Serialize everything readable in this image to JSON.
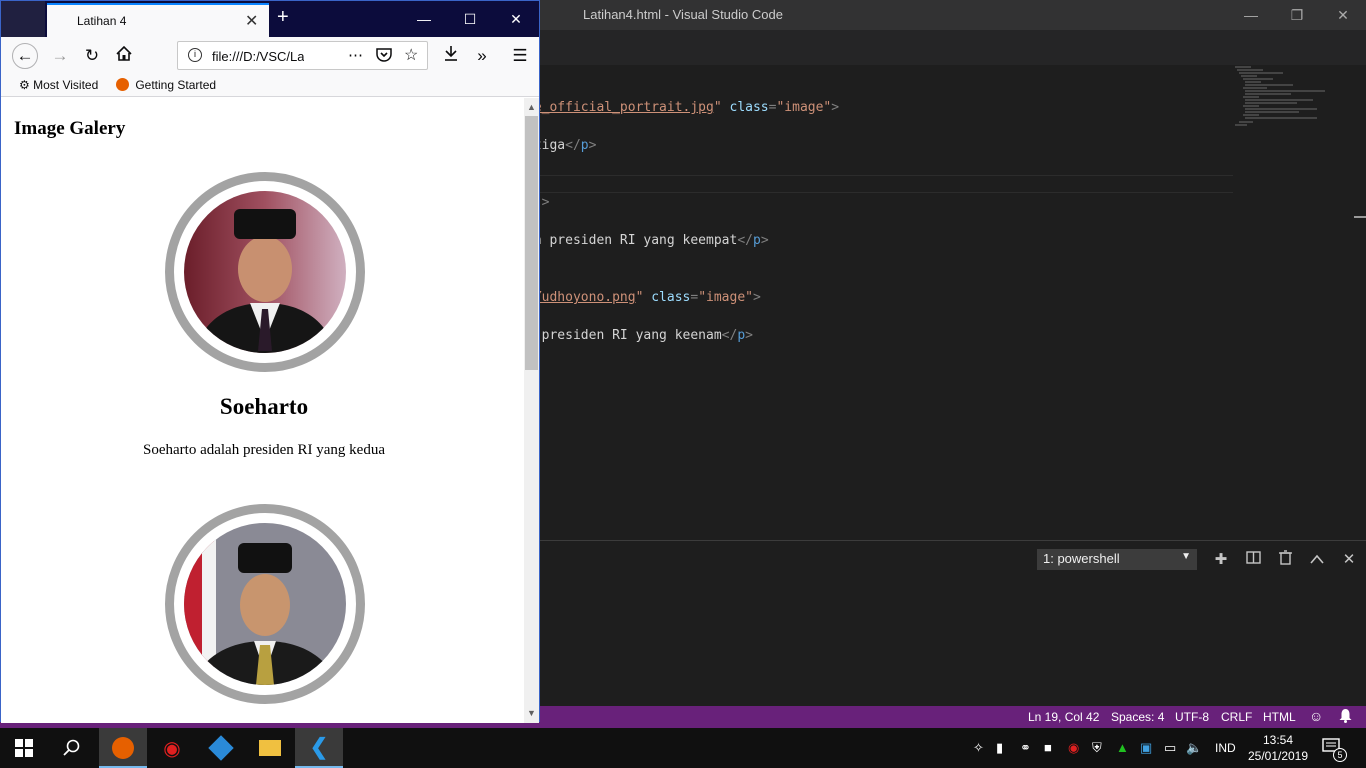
{
  "vscode": {
    "title": "Latihan4.html - Visual Studio Code",
    "code_lines": [
      {
        "parts": [
          [
            "c-link",
            "ie_official_portrait.jpg"
          ],
          [
            "c-str",
            "\""
          ],
          [
            "",
            ""
          ],
          [
            "c-attr",
            " class"
          ],
          [
            "c-punc",
            "="
          ],
          [
            "c-str",
            "\"image\""
          ],
          [
            "c-punc",
            ">"
          ]
        ]
      },
      {
        "parts": [
          [
            "",
            "etiga"
          ],
          [
            "c-punc",
            "</"
          ],
          [
            "c-tag",
            "p"
          ],
          [
            "c-punc",
            ">"
          ]
        ]
      },
      {
        "parts": [
          [
            "c-str",
            "e\""
          ],
          [
            "c-punc",
            ">"
          ]
        ]
      },
      {
        "parts": [
          [
            "",
            "ah presiden RI yang keempat"
          ],
          [
            "c-punc",
            "</"
          ],
          [
            "c-tag",
            "p"
          ],
          [
            "c-punc",
            ">"
          ]
        ]
      },
      {
        "parts": [
          [
            "c-link",
            "_Yudhoyono.png"
          ],
          [
            "c-str",
            "\""
          ],
          [
            "c-attr",
            " class"
          ],
          [
            "c-punc",
            "="
          ],
          [
            "c-str",
            "\"image\""
          ],
          [
            "c-punc",
            ">"
          ]
        ]
      },
      {
        "parts": [
          [
            "",
            "h presiden RI yang keenam"
          ],
          [
            "c-punc",
            "</"
          ],
          [
            "c-tag",
            "p"
          ],
          [
            "c-punc",
            ">"
          ]
        ]
      }
    ],
    "terminal_select": "1: powershell",
    "status": {
      "position": "Ln 19, Col 42",
      "spaces": "Spaces: 4",
      "encoding": "UTF-8",
      "eol": "CRLF",
      "language": "HTML"
    }
  },
  "firefox": {
    "tab_title": "Latihan 4",
    "url": "file:///D:/VSC/Lat",
    "bookmarks": [
      "Most Visited",
      "Getting Started"
    ],
    "page": {
      "heading": "Image Galery",
      "cards": [
        {
          "name": "Soeharto",
          "description": "Soeharto adalah presiden RI yang kedua"
        }
      ]
    }
  },
  "taskbar": {
    "language": "IND",
    "time": "13:54",
    "date": "25/01/2019",
    "notifications": "5"
  }
}
